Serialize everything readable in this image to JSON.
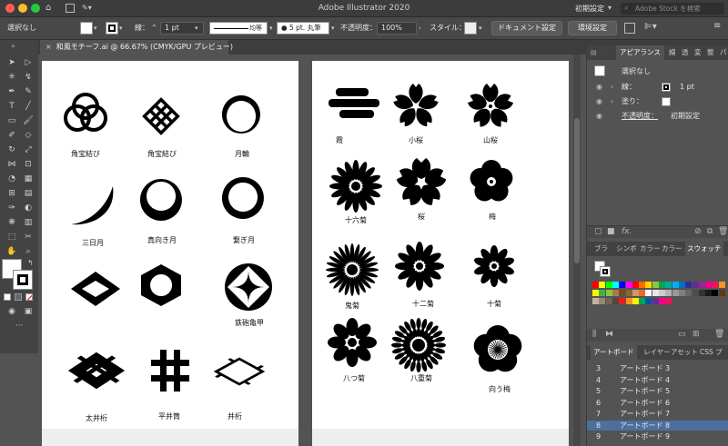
{
  "app": {
    "title": "Adobe Illustrator 2020",
    "workspace": "初期設定",
    "search_placeholder": "Adobe Stock を検索"
  },
  "control": {
    "selection": "選択なし",
    "stroke_label": "線：",
    "stroke_value": "1 pt",
    "stroke_style": "均等",
    "brush": "5 pt. 丸筆",
    "opacity_label": "不透明度：",
    "opacity_value": "100%",
    "style_label": "スタイル：",
    "doc_setup": "ドキュメント設定",
    "prefs": "環境設定"
  },
  "document": {
    "tab": "和風モチーフ.ai @ 66.67% (CMYK/GPU プレビュー)",
    "close": "×"
  },
  "artboard1": {
    "items": [
      "角宝結び",
      "角宝結び",
      "月輪",
      "三日月",
      "真向き月",
      "繋ぎ月",
      "",
      "",
      "鉄砲亀甲",
      "太井桁",
      "平井筒",
      "井桁"
    ]
  },
  "artboard2": {
    "items": [
      "霞",
      "小桜",
      "山桜",
      "十六菊",
      "桜",
      "梅",
      "鬼菊",
      "十二菊",
      "十菊",
      "八つ菊",
      "八重菊",
      "向う梅"
    ]
  },
  "appearance": {
    "tab": "アピアランス",
    "other_tabs": [
      "線",
      "透",
      "変",
      "整",
      "パ"
    ],
    "title": "選択なし",
    "stroke_label": "線：",
    "stroke_value": "1 pt",
    "fill_label": "塗り：",
    "opacity_label": "不透明度：",
    "opacity_value": "初期設定",
    "fx": "fx."
  },
  "swatches": {
    "tabs": [
      "ブラ",
      "シンボ",
      "カラー",
      "カラー",
      "スウォッチ"
    ],
    "colors": [
      "#ff0000",
      "#ffff00",
      "#00ff00",
      "#00ffff",
      "#0000ff",
      "#ff00ff",
      "#ff0000",
      "#ff6a00",
      "#ffd400",
      "#8cc63f",
      "#00a651",
      "#00a99d",
      "#00aeef",
      "#0072bc",
      "#2e3192",
      "#662d91",
      "#92278f",
      "#ec008c",
      "#ed145b",
      "#f7941d",
      "#fff200",
      "#39b54a",
      "#8dc63f",
      "#a67c52",
      "#754c24",
      "#8c6239",
      "#c69c6d",
      "#f26522",
      "#ffffff",
      "#e6e6e6",
      "#cccccc",
      "#b3b3b3",
      "#999999",
      "#808080",
      "#666666",
      "#4d4d4d",
      "#333333",
      "#1a1a1a",
      "#000000",
      "#603913",
      "#c7b299",
      "#998675",
      "#736357",
      "#534741",
      "#ed1c24",
      "#f7941d",
      "#fff200",
      "#00a651",
      "#0054a6",
      "#662d91",
      "#ec008c",
      "#ed145b"
    ]
  },
  "artboards": {
    "tabs": [
      "アートボード",
      "レイヤー",
      "アセット",
      "CSS プ"
    ],
    "rows": [
      {
        "num": "3",
        "name": "アートボード 3"
      },
      {
        "num": "4",
        "name": "アートボード 4"
      },
      {
        "num": "5",
        "name": "アートボード 5"
      },
      {
        "num": "6",
        "name": "アートボード 6"
      },
      {
        "num": "7",
        "name": "アートボード 7"
      },
      {
        "num": "8",
        "name": "アートボード 8"
      },
      {
        "num": "9",
        "name": "アートボード 9"
      }
    ]
  }
}
